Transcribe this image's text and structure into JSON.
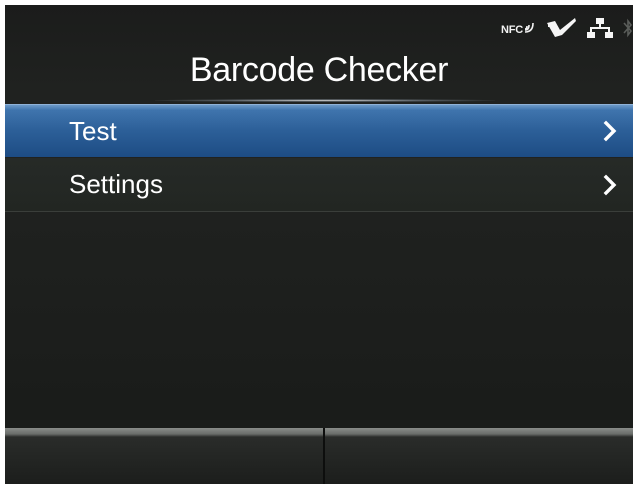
{
  "header": {
    "title": "Barcode Checker"
  },
  "status_bar": {
    "nfc_label": "NFC",
    "icons": [
      "nfc-icon",
      "barcode-checker-device-icon",
      "network-lan-icon",
      "bluetooth-icon"
    ]
  },
  "menu": {
    "items": [
      {
        "label": "Test",
        "selected": true,
        "icon": "chevron-right-icon"
      },
      {
        "label": "Settings",
        "selected": false,
        "icon": "chevron-right-icon"
      }
    ]
  },
  "softkeys": {
    "left_label": "",
    "right_label": ""
  },
  "colors": {
    "selected_row": "#2c5f98",
    "background": "#1f211f",
    "text": "#ffffff",
    "softkey_top": "#8a8d8a"
  }
}
